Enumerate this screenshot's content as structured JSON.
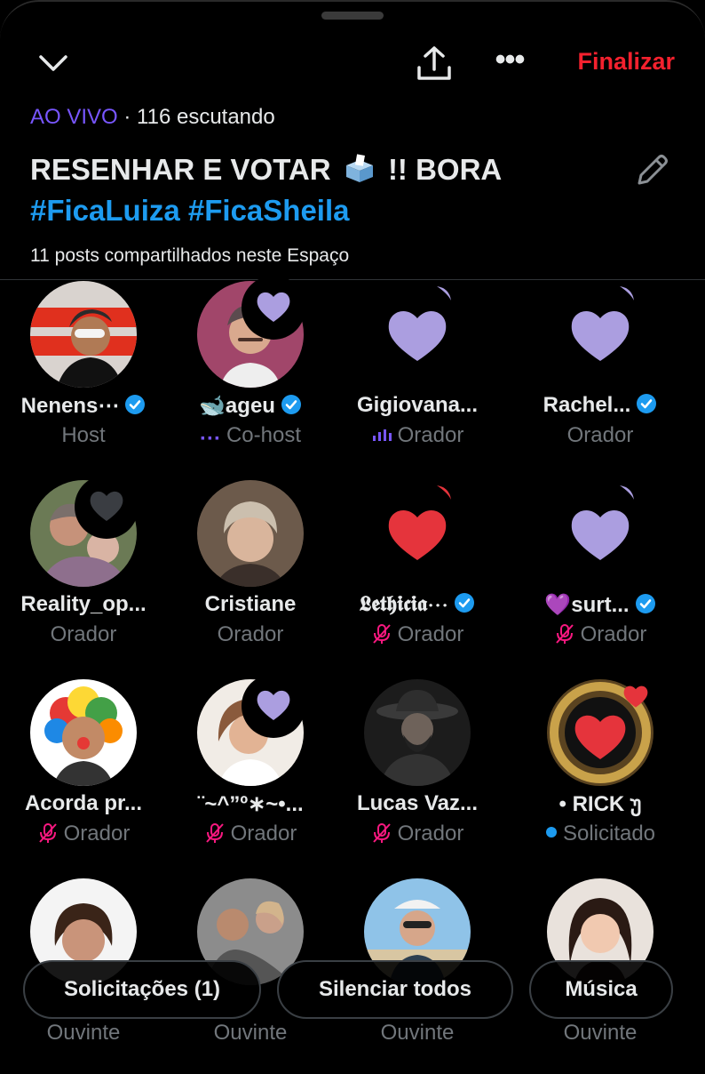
{
  "header": {
    "finalize_label": "Finalizar",
    "icons": [
      "chevron-down-icon",
      "share-icon",
      "more-icon",
      "edit-icon"
    ]
  },
  "space": {
    "live_label": "AO VIVO",
    "listeners_text": "· 116 escutando",
    "title_part1": "RESENHAR E VOTAR",
    "title_part2": "!! BORA",
    "hashtags": "#FicaLuiza #FicaSheila",
    "posts_shared": "11 posts compartilhados neste Espaço"
  },
  "participants": [
    {
      "name": "Nenens⋯",
      "role": "Host",
      "verified": true,
      "avatar": "photo"
    },
    {
      "name": "🐋ageu",
      "role": "Co-host",
      "verified": true,
      "avatar": "photo",
      "role_icon": "dots-icon"
    },
    {
      "name": "Gigiovana...",
      "role": "Orador",
      "verified": false,
      "avatar": "heart-purple",
      "role_icon": "audio-icon"
    },
    {
      "name": "Rachel...",
      "role": "Orador",
      "verified": true,
      "avatar": "heart-purple"
    },
    {
      "name": "Reality_op...",
      "role": "Orador",
      "verified": false,
      "avatar": "photo"
    },
    {
      "name": "Cristiane",
      "role": "Orador",
      "verified": false,
      "avatar": "photo"
    },
    {
      "name": "𝕷𝖊𝖙𝖍𝖎𝖈𝖎𝖆⋯",
      "role": "Orador",
      "verified": true,
      "avatar": "heart-red",
      "role_icon": "mic-off-icon"
    },
    {
      "name": "💜surt...",
      "role": "Orador",
      "verified": true,
      "avatar": "heart-purple",
      "role_icon": "mic-off-icon"
    },
    {
      "name": "Acorda pr...",
      "role": "Orador",
      "verified": false,
      "avatar": "photo",
      "role_icon": "mic-off-icon"
    },
    {
      "name": "¨~^”º∗~•...",
      "role": "Orador",
      "verified": false,
      "avatar": "photo",
      "role_icon": "mic-off-icon"
    },
    {
      "name": "Lucas Vaz...",
      "role": "Orador",
      "verified": false,
      "avatar": "photo",
      "role_icon": "mic-off-icon"
    },
    {
      "name": "• RICK უ",
      "role": "Solicitado",
      "verified": false,
      "avatar": "photo",
      "role_icon": "dot-icon"
    },
    {
      "name": "",
      "role": "Ouvinte",
      "verified": false,
      "avatar": "photo"
    },
    {
      "name": "",
      "role": "Ouvinte",
      "verified": false,
      "avatar": "photo"
    },
    {
      "name": "",
      "role": "Ouvinte",
      "verified": false,
      "avatar": "photo"
    },
    {
      "name": "",
      "role": "Ouvinte",
      "verified": false,
      "avatar": "photo"
    }
  ],
  "actions": {
    "requests_label": "Solicitações (1)",
    "mute_all_label": "Silenciar todos",
    "music_label": "Música"
  },
  "colors": {
    "live": "#7856ff",
    "hashtag": "#1d9bf0",
    "finalize": "#f4212e",
    "heart_purple": "#ab9ee0",
    "heart_red": "#e5343c"
  }
}
